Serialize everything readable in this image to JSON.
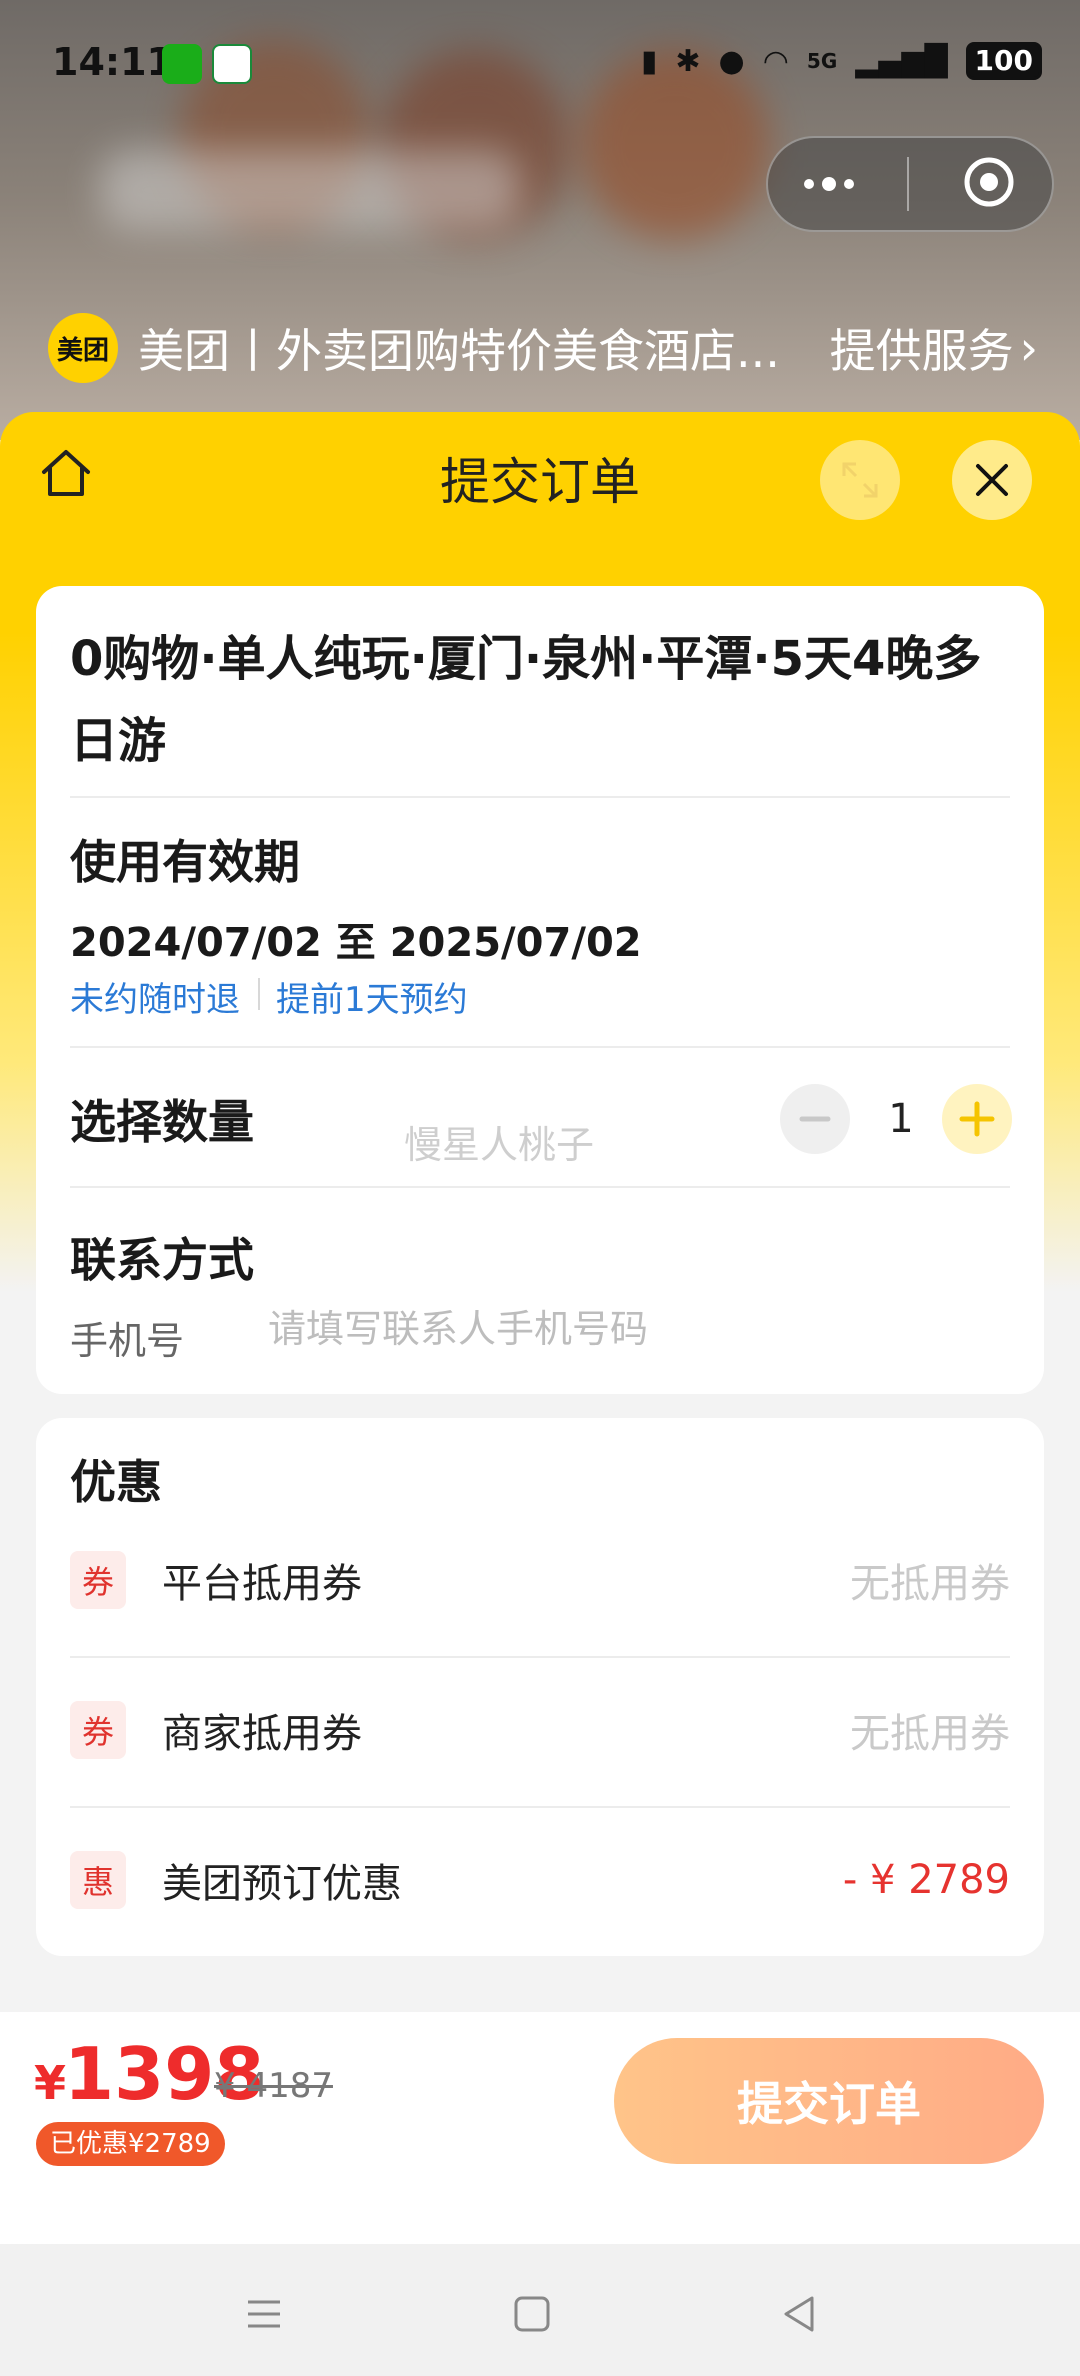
{
  "status_bar": {
    "time": "14:11",
    "network": "5G",
    "battery": "100"
  },
  "mini_program": {
    "provider_logo": "美团",
    "provider_name": "美团丨外卖团购特价美食酒店...",
    "service_link": "提供服务",
    "capsule_menu_icon": "more-dots-icon",
    "capsule_close_icon": "target-circle-icon"
  },
  "header": {
    "title": "提交订单"
  },
  "product": {
    "title": "0购物·单人纯玩·厦门·泉州·平潭·5天4晚多日游"
  },
  "validity": {
    "section_title": "使用有效期",
    "dates": "2024/07/02 至 2025/07/02",
    "tags": [
      "未约随时退",
      "提前1天预约"
    ]
  },
  "quantity": {
    "label": "选择数量",
    "value": "1",
    "watermark": "慢星人桃子"
  },
  "contact": {
    "section_title": "联系方式",
    "phone_label": "手机号",
    "phone_placeholder": "请填写联系人手机号码",
    "phone_value": ""
  },
  "discounts": {
    "section_title": "优惠",
    "items": [
      {
        "badge": "券",
        "label": "平台抵用券",
        "value": "无抵用券"
      },
      {
        "badge": "券",
        "label": "商家抵用券",
        "value": "无抵用券"
      },
      {
        "badge": "惠",
        "label": "美团预订优惠",
        "value": "- ¥ 2789"
      }
    ]
  },
  "footer": {
    "currency": "¥",
    "price": "1398",
    "original_price": "¥ 4187",
    "discount_badge": "已优惠¥2789",
    "submit_label": "提交订单"
  },
  "colors": {
    "brand_yellow": "#ffd100",
    "price_red": "#ee2c2c",
    "link_blue": "#2b7ad6",
    "submit_gradient_start": "#ffc489",
    "submit_gradient_end": "#ffab86"
  }
}
